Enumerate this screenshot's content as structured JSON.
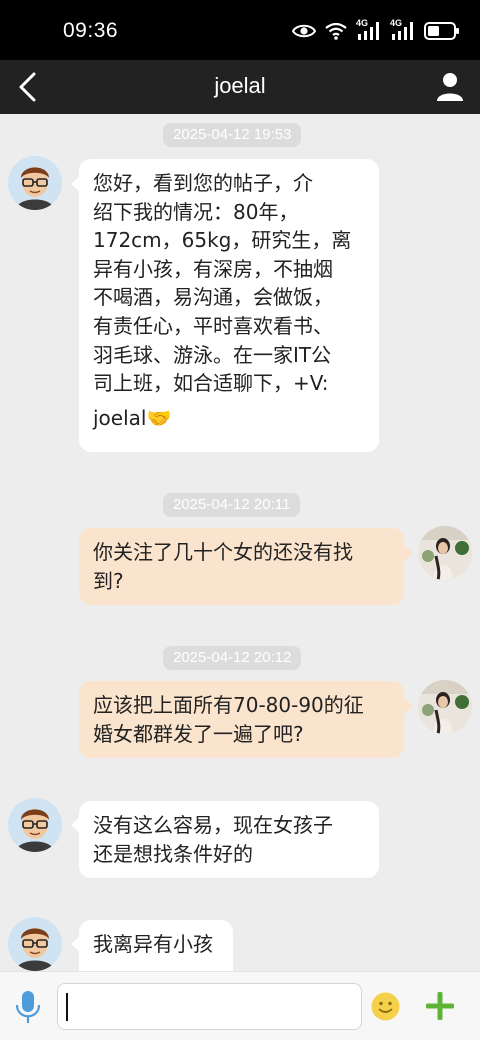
{
  "status_bar": {
    "time": "09:36",
    "signal_1_label": "4G",
    "signal_2_label": "4G"
  },
  "nav": {
    "title": "joelal"
  },
  "messages": [
    {
      "timestamp": "2025-04-12 19:53",
      "sender": "joelal",
      "direction": "in",
      "lines": [
        "您好，看到您的帖子，介",
        "绍下我的情况：80年，",
        "172cm，65kg，研究生，离",
        "异有小孩，有深房，不抽烟",
        "不喝酒，易沟通，会做饭，",
        "有责任心，平时喜欢看书、",
        "羽毛球、游泳。在一家IT公",
        "司上班，如合适聊下，+V:",
        "joelal🤝"
      ]
    },
    {
      "timestamp": "2025-04-12 20:11",
      "sender": "me",
      "direction": "out",
      "lines": [
        "你关注了几十个女的还没有找",
        "到?"
      ]
    },
    {
      "timestamp": "2025-04-12 20:12",
      "sender": "me",
      "direction": "out",
      "lines": [
        "应该把上面所有70-80-90的征",
        "婚女都群发了一遍了吧?"
      ]
    },
    {
      "sender": "joelal",
      "direction": "in",
      "lines": [
        "没有这么容易，现在女孩子",
        "还是想找条件好的"
      ]
    },
    {
      "sender": "joelal",
      "direction": "in",
      "lines": [
        "我离异有小孩"
      ]
    }
  ],
  "input": {
    "value": ""
  },
  "colors": {
    "incoming_bubble": "#ffffff",
    "outgoing_bubble": "#fbe4cd",
    "chat_background": "#ededed",
    "nav_background": "#222222",
    "plus_icon": "#5fb337",
    "emoji_icon": "#f5d04a",
    "mic_icon": "#4f9cdc"
  },
  "icons": {
    "back": "chevron-left-icon",
    "profile": "person-icon",
    "mic": "microphone-icon",
    "emoji": "smiley-icon",
    "plus": "plus-icon",
    "eye": "eye-icon",
    "wifi": "wifi-icon",
    "battery": "battery-icon"
  }
}
